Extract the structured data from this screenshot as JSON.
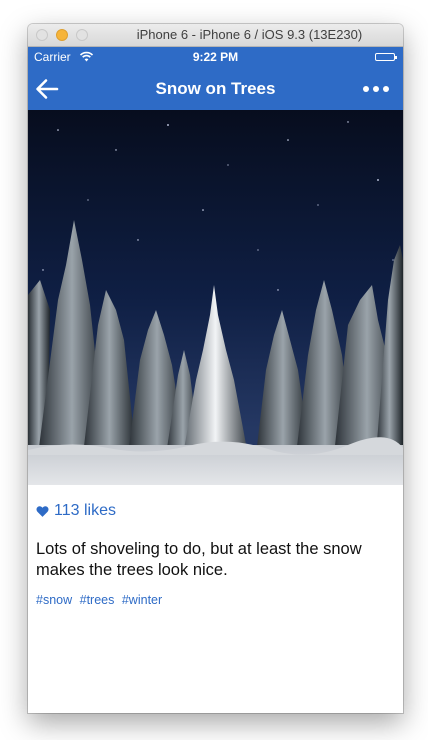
{
  "simulator": {
    "window_title": "iPhone 6 - iPhone 6 / iOS 9.3 (13E230)"
  },
  "status_bar": {
    "carrier": "Carrier",
    "time": "9:22 PM",
    "wifi_icon": "wifi-icon",
    "battery_icon": "battery-icon"
  },
  "nav_bar": {
    "title": "Snow on Trees",
    "back_icon": "back-arrow-icon",
    "more_icon": "more-dots-icon",
    "color": "#2e6bc6"
  },
  "post": {
    "image": "night sky over snow-covered pine trees",
    "likes": "113 likes",
    "like_icon": "heart-icon",
    "caption": "Lots of shoveling to do, but at least the snow makes the trees look nice.",
    "tags": [
      "#snow",
      "#trees",
      "#winter"
    ],
    "accent_color": "#2e6bc6"
  }
}
